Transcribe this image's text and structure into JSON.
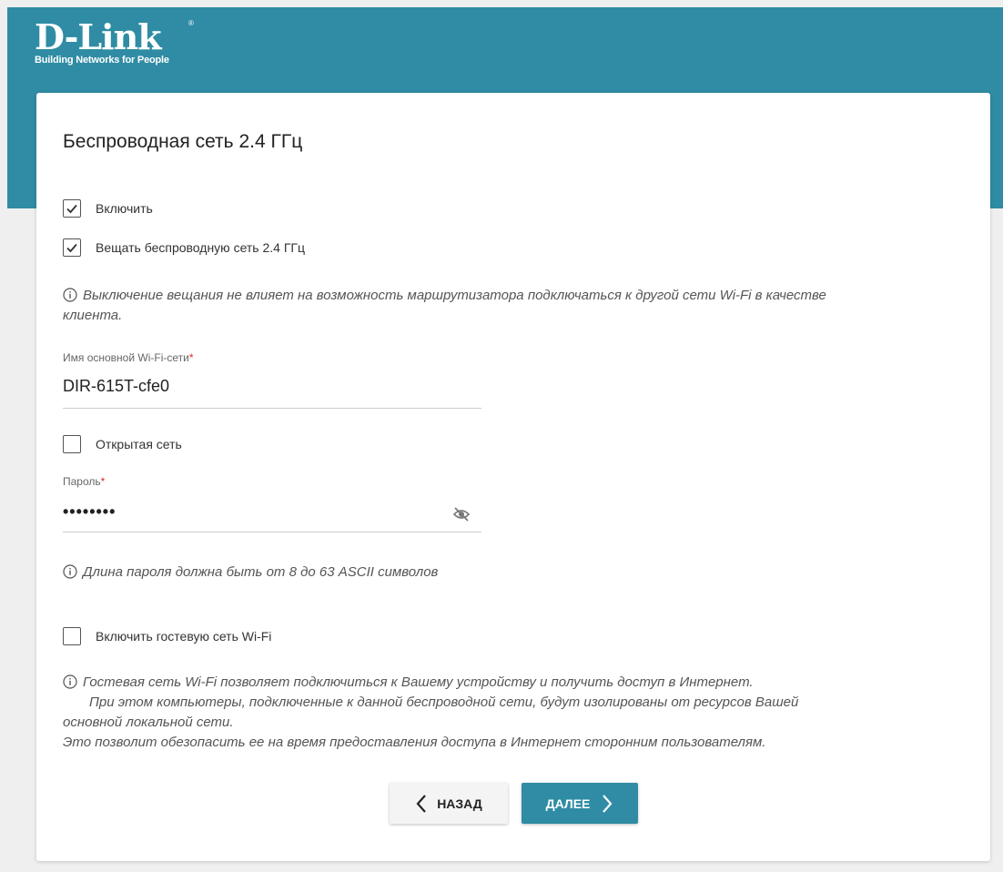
{
  "brand": {
    "logo_text": "D-Link",
    "reg_mark": "®",
    "tagline": "Building Networks for People",
    "color": "#2f8ca4"
  },
  "page": {
    "title": "Беспроводная сеть 2.4 ГГц"
  },
  "checkboxes": {
    "enable": {
      "label": "Включить",
      "checked": true
    },
    "broadcast": {
      "label": "Вещать беспроводную сеть 2.4 ГГц",
      "checked": true
    },
    "open_network": {
      "label": "Открытая сеть",
      "checked": false
    },
    "guest": {
      "label": "Включить гостевую сеть Wi-Fi",
      "checked": false
    }
  },
  "info": {
    "broadcast_note_line1": "Выключение вещания не влияет на возможность маршрутизатора подключаться к другой сети Wi-Fi в качестве",
    "broadcast_note_line2": "клиента.",
    "password_note": "Длина пароля должна быть от 8 до 63 ASCII символов",
    "guest_note_line1": "Гостевая сеть Wi-Fi позволяет подключиться к Вашему устройству и получить доступ в Интернет.",
    "guest_note_line2": "При этом компьютеры, подключенные к данной беспроводной сети, будут изолированы от ресурсов Вашей",
    "guest_note_line3": "основной локальной сети.",
    "guest_note_line4": "Это позволит обезопасить ее на время предоставления доступа в Интернет сторонним пользователям."
  },
  "fields": {
    "ssid": {
      "label": "Имя основной Wi-Fi-сети",
      "required_mark": "*",
      "value": "DIR-615T-cfe0"
    },
    "password": {
      "label": "Пароль",
      "required_mark": "*",
      "value": "••••••••"
    }
  },
  "buttons": {
    "back": "НАЗАД",
    "next": "ДАЛЕЕ"
  },
  "icons": {
    "info": "info-circle-icon",
    "check": "checkmark-icon",
    "eye": "eye-slash-icon",
    "back": "chevron-left-icon",
    "next": "chevron-right-icon"
  }
}
